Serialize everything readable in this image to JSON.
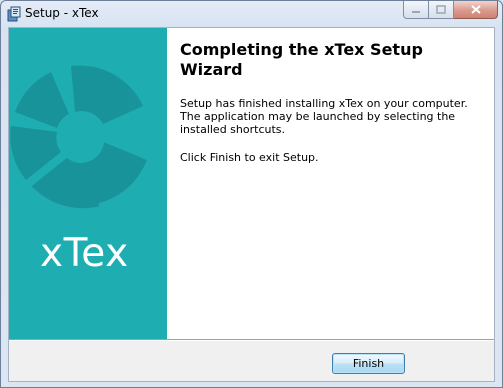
{
  "window": {
    "title": "Setup - xTex",
    "icon": "installer-icon"
  },
  "caption_buttons": [
    "minimize-icon",
    "maximize-icon",
    "close-icon"
  ],
  "banner": {
    "brand": "xTex",
    "background": "#1eadb1"
  },
  "content": {
    "heading": "Completing the xTex Setup Wizard",
    "paragraph1": "Setup has finished installing xTex on your computer. The application may be launched by selecting the installed shortcuts.",
    "paragraph2": "Click Finish to exit Setup."
  },
  "footer": {
    "finish_label": "Finish"
  }
}
